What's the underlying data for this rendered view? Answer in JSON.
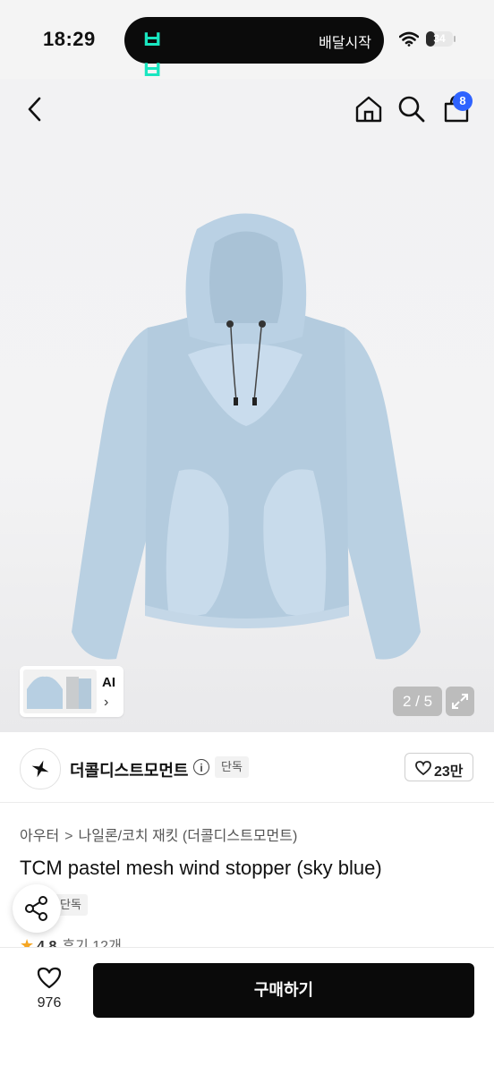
{
  "status_bar": {
    "time": "18:29",
    "live_activity_logo": "ㅂㅂ",
    "live_activity_text": "배달시작",
    "battery_level": 34,
    "battery_text": "34"
  },
  "nav": {
    "back_icon": "chevron-left-icon",
    "home_icon": "home-icon",
    "search_icon": "search-icon",
    "cart_icon": "shopping-bag-icon",
    "cart_count": "8"
  },
  "gallery": {
    "thumbnail_label": "AI",
    "thumbnail_chevron": "›",
    "pager": "2 / 5",
    "expand_icon": "expand-icon",
    "jacket_color": "#b7cfe2"
  },
  "brand": {
    "name": "더콜디스트모먼트",
    "info_icon": "info-icon",
    "info_glyph": "i",
    "tag": "단독",
    "likes": "23만"
  },
  "product": {
    "breadcrumb": [
      "아우터",
      "나일론/코치 재킷 (더콜디스트모먼트)"
    ],
    "breadcrumb_sep": ">",
    "title": "TCM pastel mesh wind stopper (sky blue)",
    "tag": "단독",
    "rating_star": "★",
    "rating": "4.8",
    "reviews": "후기 12개"
  },
  "bottom": {
    "wish_count": "976",
    "buy_label": "구매하기"
  },
  "colors": {
    "accent_badge": "#2f63ff",
    "buy_button": "#0a0a0a",
    "star": "#f5a623",
    "island_logo": "#19e6c0"
  }
}
